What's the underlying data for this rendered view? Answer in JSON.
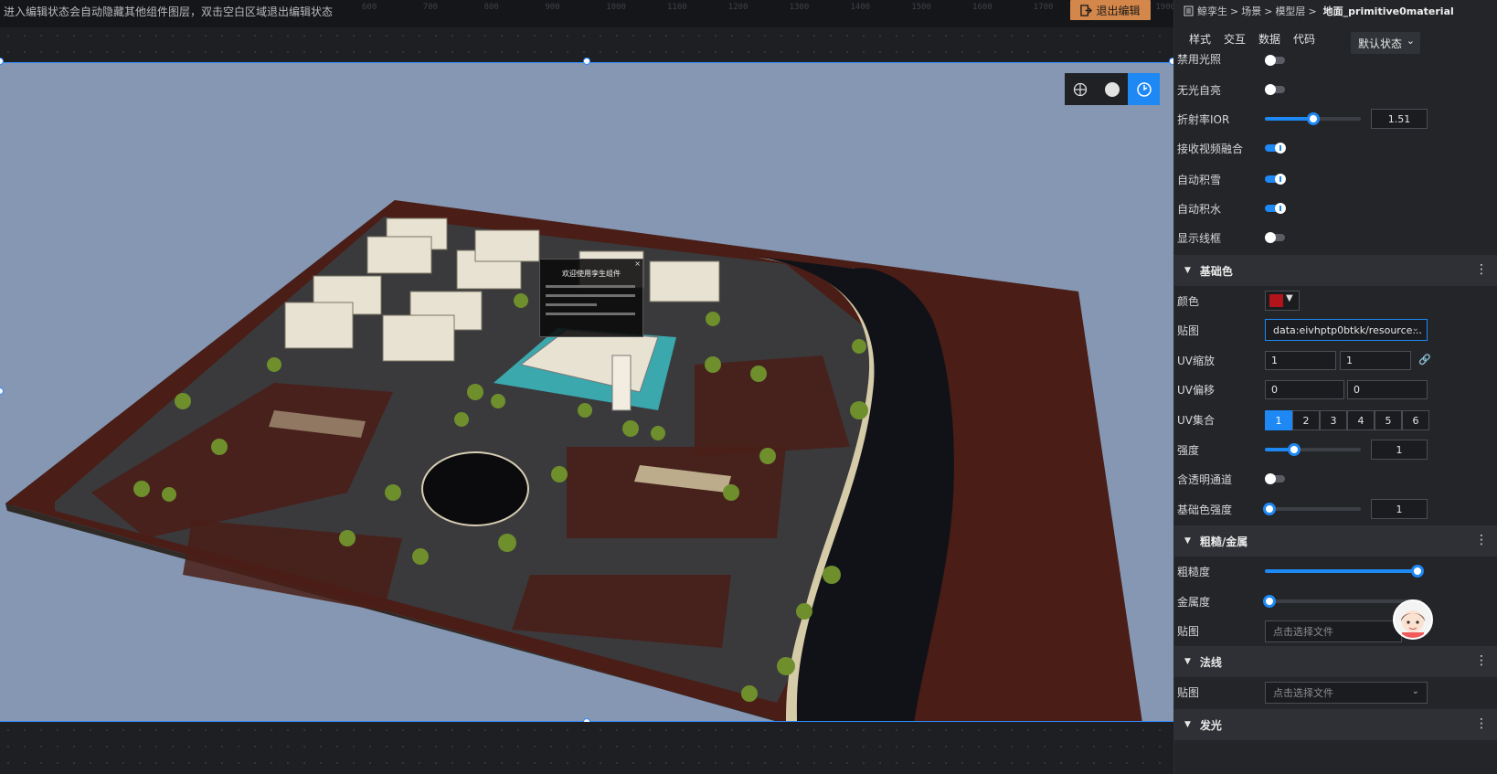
{
  "topbar": {
    "hint": "进入编辑状态会自动隐藏其他组件图层，双击空白区域退出编辑状态",
    "ruler_ticks": [
      "600",
      "700",
      "800",
      "900",
      "1000",
      "1100",
      "1200",
      "1300",
      "1400",
      "1500",
      "1600",
      "1700",
      "1800",
      "1900"
    ],
    "exit_label": "退出编辑"
  },
  "viewport": {
    "background": "#8597b2",
    "popup": {
      "title": "欢迎使用孪生组件",
      "close": "×"
    },
    "tools": [
      "globe-icon",
      "sphere-icon",
      "rotate-icon"
    ]
  },
  "panel": {
    "breadcrumbs": [
      "鲸孪生",
      "场景",
      "模型层",
      "地面_primitive0material"
    ],
    "separator": ">",
    "tabs": [
      "样式",
      "交互",
      "数据",
      "代码"
    ],
    "state_select": "默认状态",
    "rows": {
      "disable_light": "禁用光照",
      "unlit_self": "无光自亮",
      "ior": {
        "label": "折射率IOR",
        "value": "1.51",
        "fraction": 0.5
      },
      "video_fusion": "接收视频融合",
      "auto_snow": "自动积雪",
      "auto_water": "自动积水",
      "wireframe": "显示线框"
    },
    "base_color": {
      "section": "基础色",
      "color_label": "颜色",
      "color_value": "#b3141c",
      "map_label": "贴图",
      "map_value": "data:eivhptp0btkk/resource...",
      "uv_scale_label": "UV缩放",
      "uv_scale": [
        "1",
        "1"
      ],
      "uv_offset_label": "UV偏移",
      "uv_offset": [
        "0",
        "0"
      ],
      "uv_set_label": "UV集合",
      "uv_set": [
        "1",
        "2",
        "3",
        "4",
        "5",
        "6"
      ],
      "strength_label": "强度",
      "strength_value": "1",
      "strength_fraction": 0.3,
      "alpha_label": "含透明通道",
      "color_strength_label": "基础色强度",
      "color_strength_value": "1",
      "color_strength_fraction": 0.0
    },
    "rough_metal": {
      "section": "粗糙/金属",
      "roughness_label": "粗糙度",
      "roughness_fraction": 1.0,
      "metalness_label": "金属度",
      "metalness_fraction": 0.0,
      "map_label": "贴图",
      "map_placeholder": "点击选择文件"
    },
    "normal": {
      "section": "法线",
      "map_label": "贴图",
      "map_placeholder": "点击选择文件"
    },
    "emissive": {
      "section": "发光"
    }
  }
}
